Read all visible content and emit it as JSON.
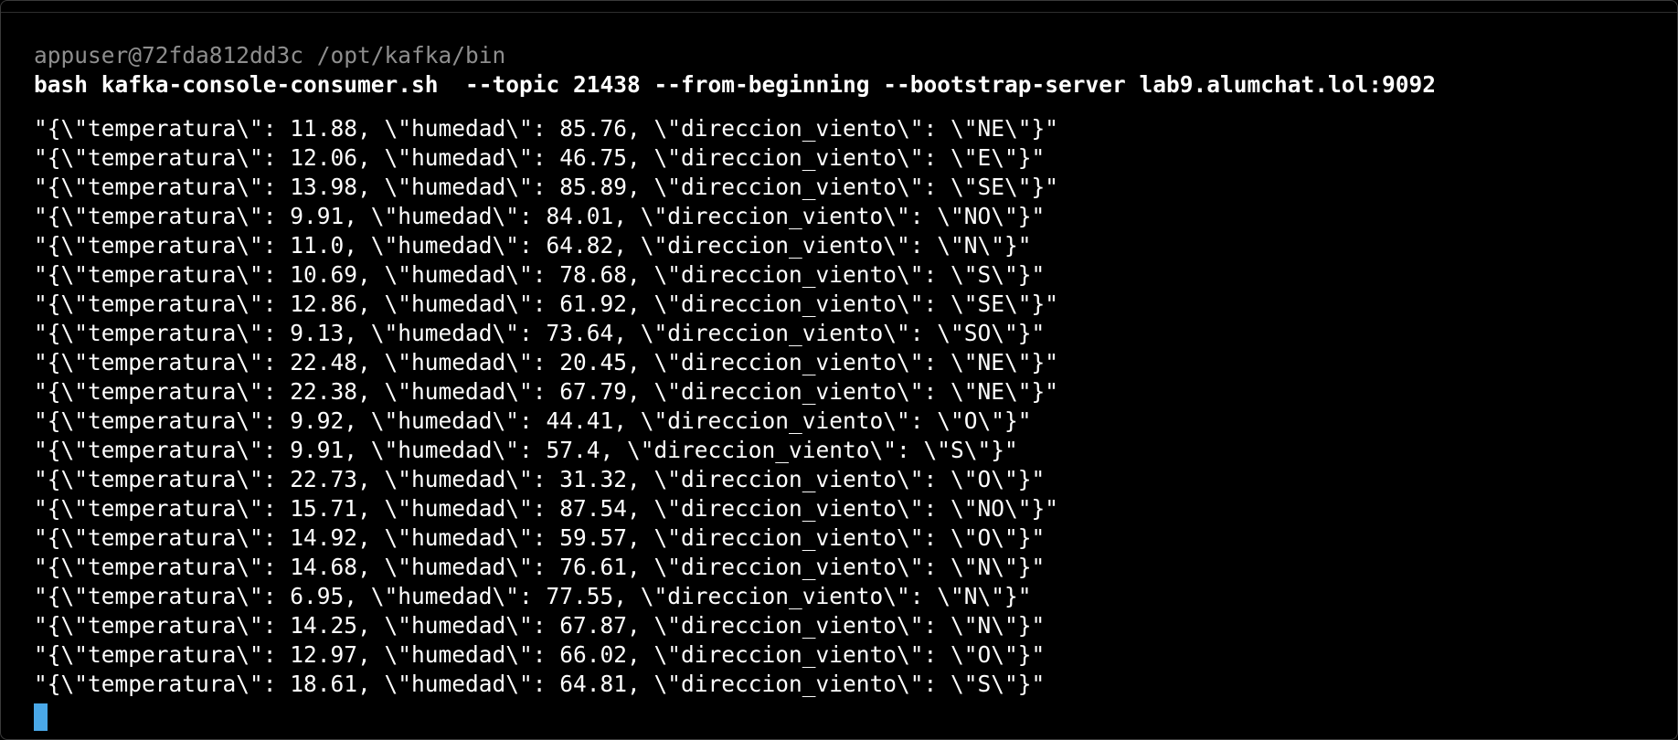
{
  "terminal": {
    "prompt_path": "appuser@72fda812dd3c /opt/kafka/bin",
    "command": "bash kafka-console-consumer.sh  --topic 21438 --from-beginning --bootstrap-server lab9.alumchat.lol:9092",
    "cursor_color": "#4aa8e8",
    "output_lines": [
      "\"{\\\"temperatura\\\": 11.88, \\\"humedad\\\": 85.76, \\\"direccion_viento\\\": \\\"NE\\\"}\"",
      "\"{\\\"temperatura\\\": 12.06, \\\"humedad\\\": 46.75, \\\"direccion_viento\\\": \\\"E\\\"}\"",
      "\"{\\\"temperatura\\\": 13.98, \\\"humedad\\\": 85.89, \\\"direccion_viento\\\": \\\"SE\\\"}\"",
      "\"{\\\"temperatura\\\": 9.91, \\\"humedad\\\": 84.01, \\\"direccion_viento\\\": \\\"NO\\\"}\"",
      "\"{\\\"temperatura\\\": 11.0, \\\"humedad\\\": 64.82, \\\"direccion_viento\\\": \\\"N\\\"}\"",
      "\"{\\\"temperatura\\\": 10.69, \\\"humedad\\\": 78.68, \\\"direccion_viento\\\": \\\"S\\\"}\"",
      "\"{\\\"temperatura\\\": 12.86, \\\"humedad\\\": 61.92, \\\"direccion_viento\\\": \\\"SE\\\"}\"",
      "\"{\\\"temperatura\\\": 9.13, \\\"humedad\\\": 73.64, \\\"direccion_viento\\\": \\\"SO\\\"}\"",
      "\"{\\\"temperatura\\\": 22.48, \\\"humedad\\\": 20.45, \\\"direccion_viento\\\": \\\"NE\\\"}\"",
      "\"{\\\"temperatura\\\": 22.38, \\\"humedad\\\": 67.79, \\\"direccion_viento\\\": \\\"NE\\\"}\"",
      "\"{\\\"temperatura\\\": 9.92, \\\"humedad\\\": 44.41, \\\"direccion_viento\\\": \\\"O\\\"}\"",
      "\"{\\\"temperatura\\\": 9.91, \\\"humedad\\\": 57.4, \\\"direccion_viento\\\": \\\"S\\\"}\"",
      "\"{\\\"temperatura\\\": 22.73, \\\"humedad\\\": 31.32, \\\"direccion_viento\\\": \\\"O\\\"}\"",
      "\"{\\\"temperatura\\\": 15.71, \\\"humedad\\\": 87.54, \\\"direccion_viento\\\": \\\"NO\\\"}\"",
      "\"{\\\"temperatura\\\": 14.92, \\\"humedad\\\": 59.57, \\\"direccion_viento\\\": \\\"O\\\"}\"",
      "\"{\\\"temperatura\\\": 14.68, \\\"humedad\\\": 76.61, \\\"direccion_viento\\\": \\\"N\\\"}\"",
      "\"{\\\"temperatura\\\": 6.95, \\\"humedad\\\": 77.55, \\\"direccion_viento\\\": \\\"N\\\"}\"",
      "\"{\\\"temperatura\\\": 14.25, \\\"humedad\\\": 67.87, \\\"direccion_viento\\\": \\\"N\\\"}\"",
      "\"{\\\"temperatura\\\": 12.97, \\\"humedad\\\": 66.02, \\\"direccion_viento\\\": \\\"O\\\"}\"",
      "\"{\\\"temperatura\\\": 18.61, \\\"humedad\\\": 64.81, \\\"direccion_viento\\\": \\\"S\\\"}\""
    ]
  }
}
